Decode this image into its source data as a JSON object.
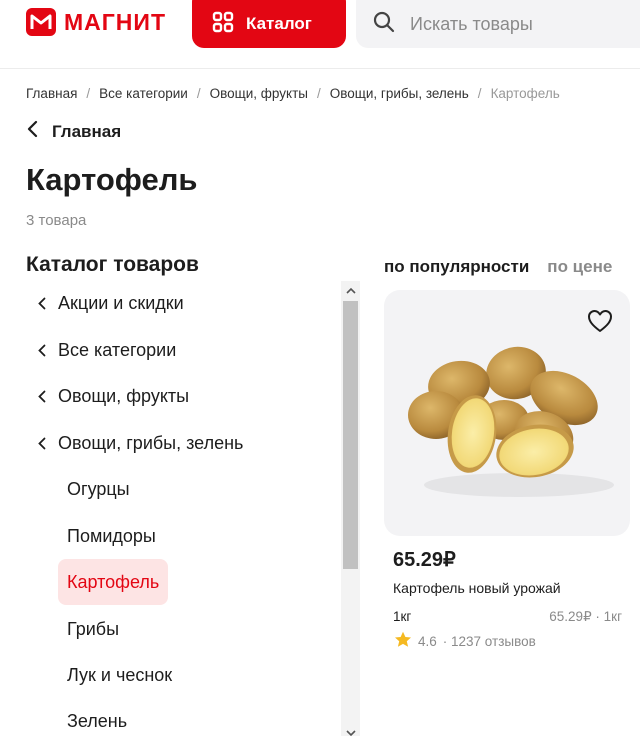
{
  "brand": {
    "name": "МАГНИТ",
    "color": "#e30613"
  },
  "header": {
    "catalog_label": "Каталог",
    "search_placeholder": "Искать товары"
  },
  "breadcrumb": [
    "Главная",
    "Все категории",
    "Овощи, фрукты",
    "Овощи, грибы, зелень",
    "Картофель"
  ],
  "back_label": "Главная",
  "page_title": "Картофель",
  "items_count": "3 товара",
  "catalog": {
    "title": "Каталог товаров",
    "parents": [
      "Акции и скидки",
      "Все категории",
      "Овощи, фрукты",
      "Овощи, грибы, зелень"
    ],
    "children": [
      "Огурцы",
      "Помидоры",
      "Картофель",
      "Грибы",
      "Лук и чеснок",
      "Зелень"
    ],
    "active": "Картофель"
  },
  "sort": {
    "options": [
      "по популярности",
      "по цене"
    ],
    "selected": "по популярности"
  },
  "product": {
    "price": "65.29₽",
    "name": "Картофель новый урожай",
    "weight": "1кг",
    "unit_price": "65.29₽ · 1кг",
    "rating": "4.6",
    "reviews": "· 1237 отзывов"
  },
  "icons": [
    "magnit-logo-icon",
    "catalog-grid-icon",
    "search-icon",
    "chevron-left-icon",
    "heart-icon",
    "star-icon",
    "scroll-up-icon",
    "scroll-down-icon"
  ]
}
